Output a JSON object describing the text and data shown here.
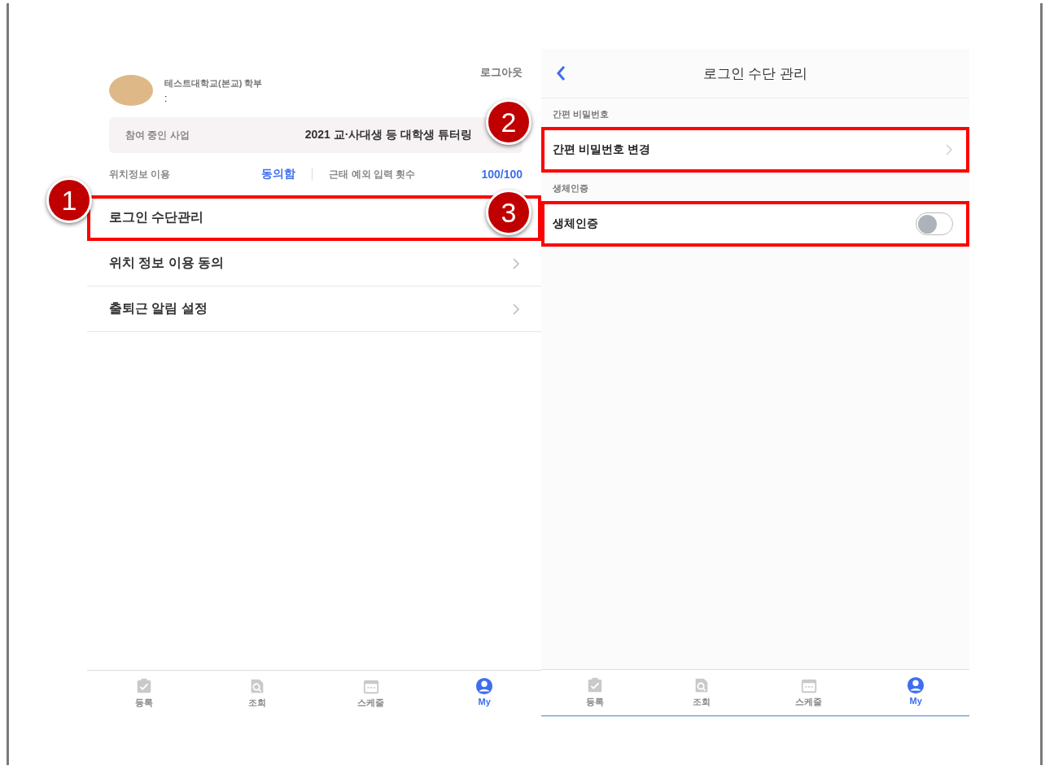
{
  "left_screen": {
    "logout": "로그아웃",
    "profile": {
      "affiliation": "테스트대학교(본교) 학부",
      "detail": ":"
    },
    "program": {
      "label": "참여 중인 사업",
      "value": "2021 교·사대생 등 대학생 튜터링"
    },
    "stats": [
      {
        "label": "위치정보 이용",
        "value": "동의함"
      },
      {
        "label": "근태 예외 입력 횟수",
        "value": "100/100"
      }
    ],
    "menu": [
      {
        "label": "로그인 수단관리",
        "chevron": false,
        "callout": "1"
      },
      {
        "label": "위치 정보 이용 동의",
        "chevron": true
      },
      {
        "label": "출퇴근 알림 설정",
        "chevron": true
      }
    ],
    "tabs": [
      {
        "label": "등록",
        "selected": false
      },
      {
        "label": "조회",
        "selected": false
      },
      {
        "label": "스케줄",
        "selected": false
      },
      {
        "label": "My",
        "selected": true
      }
    ]
  },
  "right_screen": {
    "title": "로그인 수단 관리",
    "sections": [
      {
        "header": "간편 비밀번호",
        "rows": [
          {
            "kind": "link",
            "label": "간편 비밀번호 변경",
            "callout": "2"
          }
        ]
      },
      {
        "header": "생체인증",
        "rows": [
          {
            "kind": "toggle",
            "label": "생체인증",
            "on": false,
            "callout": "3"
          }
        ]
      }
    ],
    "tabs": [
      {
        "label": "등록",
        "selected": false
      },
      {
        "label": "조회",
        "selected": false
      },
      {
        "label": "스케줄",
        "selected": false
      },
      {
        "label": "My",
        "selected": true
      }
    ]
  }
}
